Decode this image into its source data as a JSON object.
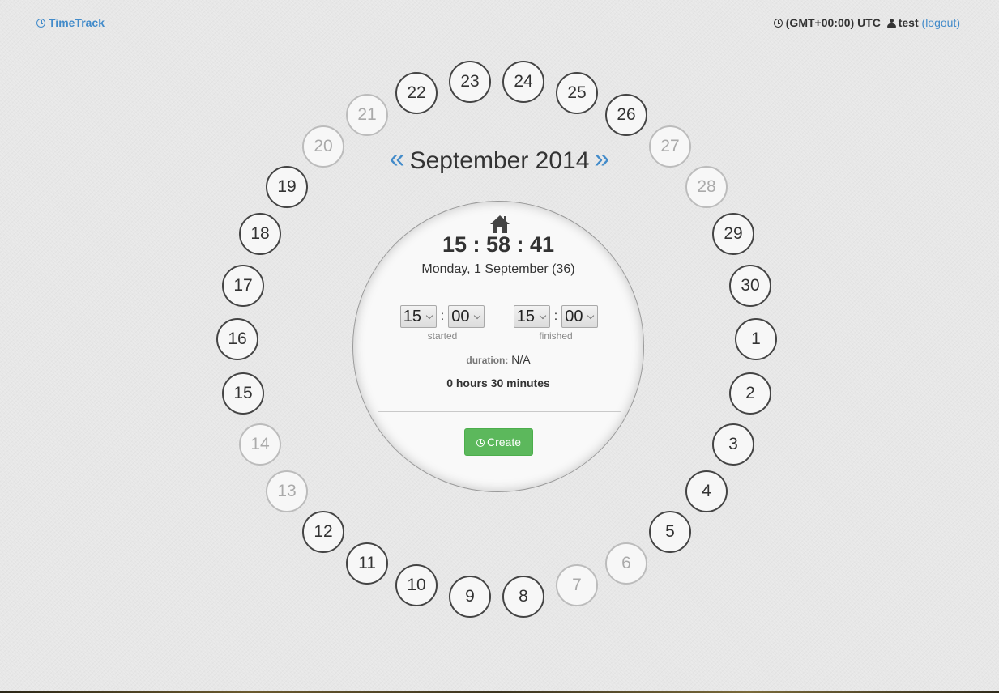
{
  "header": {
    "brand": "TimeTrack",
    "timezone": "(GMT+00:00) UTC",
    "username": "test",
    "logout_label": "(logout)"
  },
  "calendar": {
    "month_label": "September 2014",
    "prev_label": "«",
    "next_label": "»",
    "days": [
      {
        "label": "22",
        "weekend": false
      },
      {
        "label": "23",
        "weekend": false
      },
      {
        "label": "24",
        "weekend": false
      },
      {
        "label": "25",
        "weekend": false
      },
      {
        "label": "26",
        "weekend": false
      },
      {
        "label": "27",
        "weekend": true
      },
      {
        "label": "28",
        "weekend": true
      },
      {
        "label": "29",
        "weekend": false
      },
      {
        "label": "30",
        "weekend": false
      },
      {
        "label": "1",
        "weekend": false
      },
      {
        "label": "2",
        "weekend": false
      },
      {
        "label": "3",
        "weekend": false
      },
      {
        "label": "4",
        "weekend": false
      },
      {
        "label": "5",
        "weekend": false
      },
      {
        "label": "6",
        "weekend": true
      },
      {
        "label": "7",
        "weekend": true
      },
      {
        "label": "8",
        "weekend": false
      },
      {
        "label": "9",
        "weekend": false
      },
      {
        "label": "10",
        "weekend": false
      },
      {
        "label": "11",
        "weekend": false
      },
      {
        "label": "12",
        "weekend": false
      },
      {
        "label": "13",
        "weekend": true
      },
      {
        "label": "14",
        "weekend": true
      },
      {
        "label": "15",
        "weekend": false
      },
      {
        "label": "16",
        "weekend": false
      },
      {
        "label": "17",
        "weekend": false
      },
      {
        "label": "18",
        "weekend": false
      },
      {
        "label": "19",
        "weekend": false
      },
      {
        "label": "20",
        "weekend": true
      },
      {
        "label": "21",
        "weekend": true
      }
    ]
  },
  "panel": {
    "clock": "15 : 58 : 41",
    "date": "Monday, 1 September (36)",
    "started": {
      "hour": "15",
      "minute": "00",
      "caption": "started"
    },
    "finished": {
      "hour": "15",
      "minute": "00",
      "caption": "finished"
    },
    "separator": ":",
    "duration_label": "duration:",
    "duration_value": "N/A",
    "hours_text": "0 hours 30 minutes",
    "create_label": "Create"
  },
  "colors": {
    "accent": "#428bca",
    "create": "#5cb85c",
    "weekend": "#bcbcbc"
  }
}
